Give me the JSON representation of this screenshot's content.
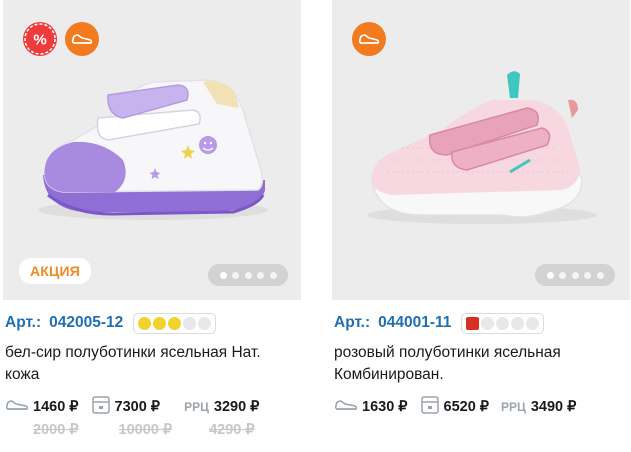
{
  "products": [
    {
      "article_label": "Арт.:",
      "article": "042005-12",
      "stock_dots": [
        "yellow",
        "yellow",
        "yellow",
        "empty",
        "empty"
      ],
      "title_line1": "бел-сир полуботинки ясельная Нат.",
      "title_line2": "кожа",
      "promo_tag": "АКЦИЯ",
      "badges": [
        "percent-icon",
        "shoe-icon"
      ],
      "prices": {
        "pair": "1460 ₽",
        "pair_old": "2000 ₽",
        "box": "7300 ₽",
        "box_old": "10000 ₽",
        "rrc_label": "РРЦ",
        "rrc": "3290 ₽",
        "rrc_old": "4290 ₽"
      },
      "photo_dots": 5,
      "colors": {
        "accent": "#8b6fd1",
        "upper": "#f6f4f8"
      }
    },
    {
      "article_label": "Арт.:",
      "article": "044001-11",
      "stock_dots": [
        "red",
        "empty",
        "empty",
        "empty",
        "empty"
      ],
      "title_line1": "розовый полуботинки ясельная",
      "title_line2": "Комбинирован.",
      "badges": [
        "shoe-icon"
      ],
      "prices": {
        "pair": "1630 ₽",
        "box": "6520 ₽",
        "rrc_label": "РРЦ",
        "rrc": "3490 ₽"
      },
      "photo_dots": 5,
      "colors": {
        "accent": "#e8a8bd",
        "upper": "#f7d9e2"
      }
    }
  ],
  "colors": {
    "link_blue": "#1f6fb2",
    "sale_red": "#ef3b3b",
    "shoe_orange": "#f27a1f",
    "promo_orange": "#f08a24",
    "old_price_gray": "#c7c7c7"
  }
}
